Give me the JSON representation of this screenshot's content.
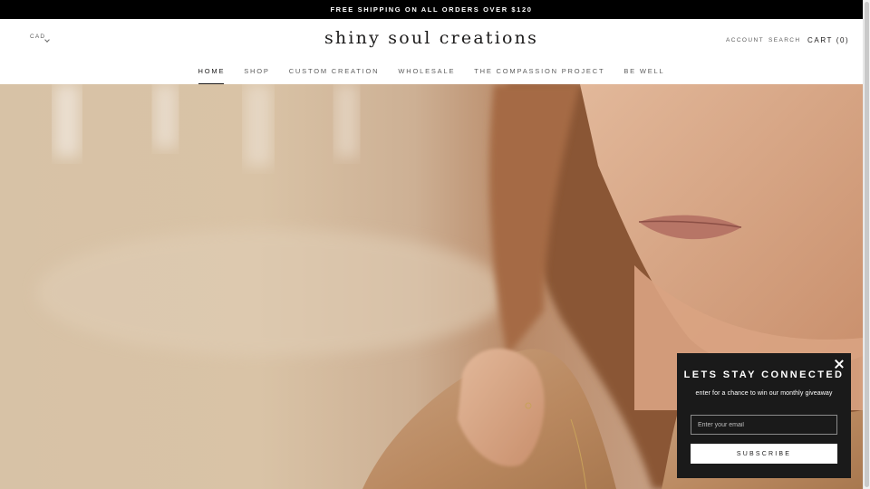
{
  "announcement": "FREE SHIPPING ON ALL ORDERS OVER $120",
  "header": {
    "currency": "CAD",
    "logo": "shiny soul creations",
    "account": "ACCOUNT",
    "search": "SEARCH",
    "cart": "CART (0)"
  },
  "nav": {
    "items": [
      {
        "label": "HOME",
        "active": true
      },
      {
        "label": "SHOP",
        "active": false
      },
      {
        "label": "CUSTOM CREATION",
        "active": false
      },
      {
        "label": "WHOLESALE",
        "active": false
      },
      {
        "label": "THE COMPASSION PROJECT",
        "active": false
      },
      {
        "label": "BE WELL",
        "active": false
      }
    ]
  },
  "hero": {
    "image": "woman-wearing-gold-necklace-with-black-stone-pendant-and-ring"
  },
  "popup": {
    "title": "LETS STAY CONNECTED",
    "subtitle": "enter for a chance to win our monthly giveaway",
    "email_placeholder": "Enter your email",
    "subscribe_label": "SUBSCRIBE",
    "close_icon": "close-icon"
  },
  "colors": {
    "announcement_bg": "#000000",
    "popup_bg": "#1a1a1a",
    "text": "#1c1b1b",
    "muted_text": "#5c5c5c"
  }
}
